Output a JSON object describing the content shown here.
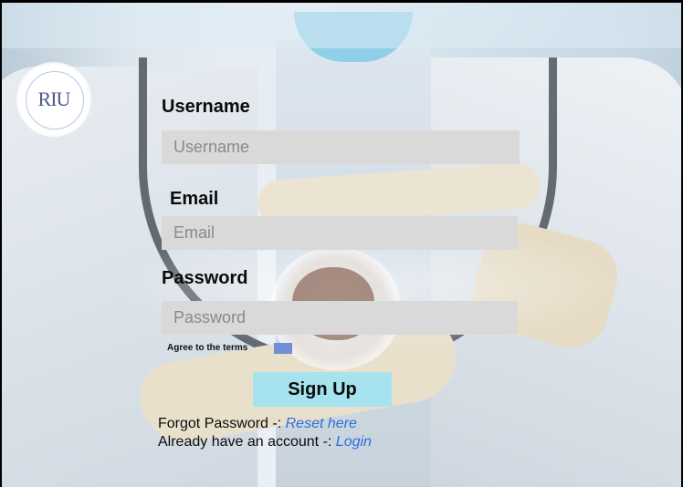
{
  "logo": {
    "text": "RIU"
  },
  "form": {
    "username_label": "Username",
    "username_placeholder": "Username",
    "email_label": "Email",
    "email_placeholder": "Email",
    "password_label": "Password",
    "password_placeholder": "Password",
    "terms_label": "Agree to the terms",
    "signup_label": "Sign Up",
    "forgot_prefix": "Forgot Password -:",
    "forgot_link": "Reset here",
    "account_prefix": "Already have an account -:",
    "login_link": "Login"
  },
  "colors": {
    "field_bg": "#d9d9d9",
    "button_bg": "#a6e3ef",
    "checkbox": "#6f8fd8",
    "link": "#2d6fd8"
  },
  "icons": {
    "logo": "university-seal-logo"
  }
}
